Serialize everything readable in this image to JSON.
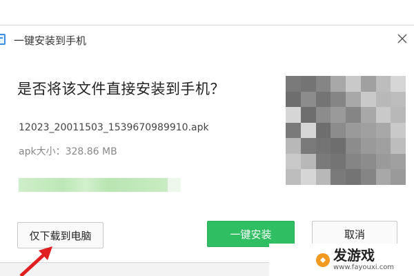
{
  "dialog": {
    "title": "一键安装到手机",
    "question": "是否将该文件直接安装到手机？",
    "file_name": "12023_20011503_1539670989910.apk",
    "file_size": "apk大小：328.86 MB",
    "progress_fraction": 0.92,
    "buttons": {
      "download_only": "仅下载到电脑",
      "install": "一键安装",
      "cancel": "取消"
    }
  },
  "watermark": {
    "name": "发游戏",
    "url": "www.fayouxi.com"
  },
  "colors": {
    "install_button": "#2fbe62",
    "progress": "#c6ecc0",
    "arrow": "#e02020"
  }
}
